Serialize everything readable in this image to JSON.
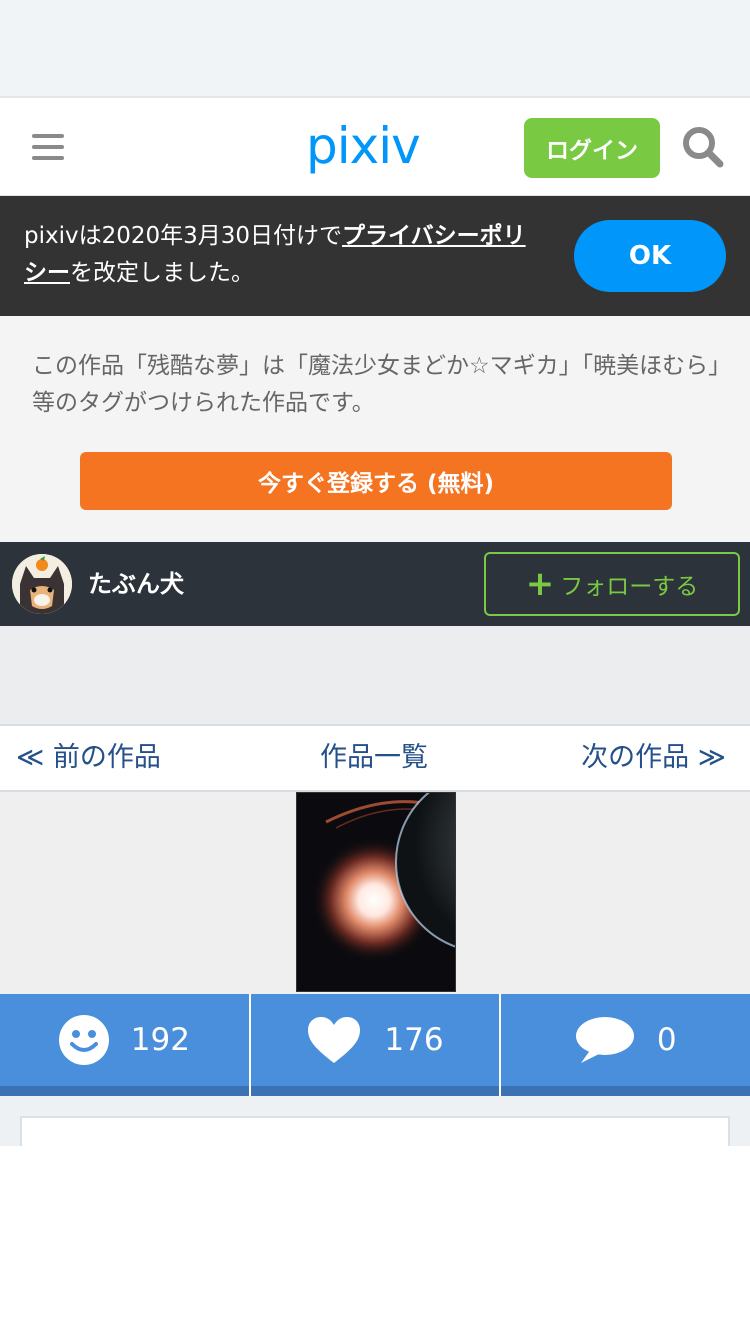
{
  "header": {
    "logo": "pixiv",
    "login_label": "ログイン"
  },
  "notice": {
    "text_before": "pixivは2020年3月30日付けで",
    "link": "プライバシーポリシー",
    "text_after": "を改定しました。",
    "ok_label": "OK"
  },
  "intro": {
    "description": "この作品「残酷な夢」は「魔法少女まどか☆マギカ」「暁美ほむら」等のタグがつけられた作品です。",
    "register_label": "今すぐ登録する (無料)"
  },
  "user": {
    "name": "たぶん犬",
    "follow_plus": "+",
    "follow_label": "フォローする"
  },
  "pager": {
    "prev": "≪ 前の作品",
    "list": "作品一覧",
    "next": "次の作品 ≫"
  },
  "stats": {
    "views": "192",
    "likes": "176",
    "comments": "0"
  },
  "colors": {
    "brand": "#0096fa",
    "login_green": "#7ac943",
    "register_orange": "#f47421",
    "stats_blue": "#4a8fdc"
  },
  "icons": [
    "menu-icon",
    "search-icon",
    "smile-icon",
    "heart-icon",
    "comment-icon"
  ]
}
